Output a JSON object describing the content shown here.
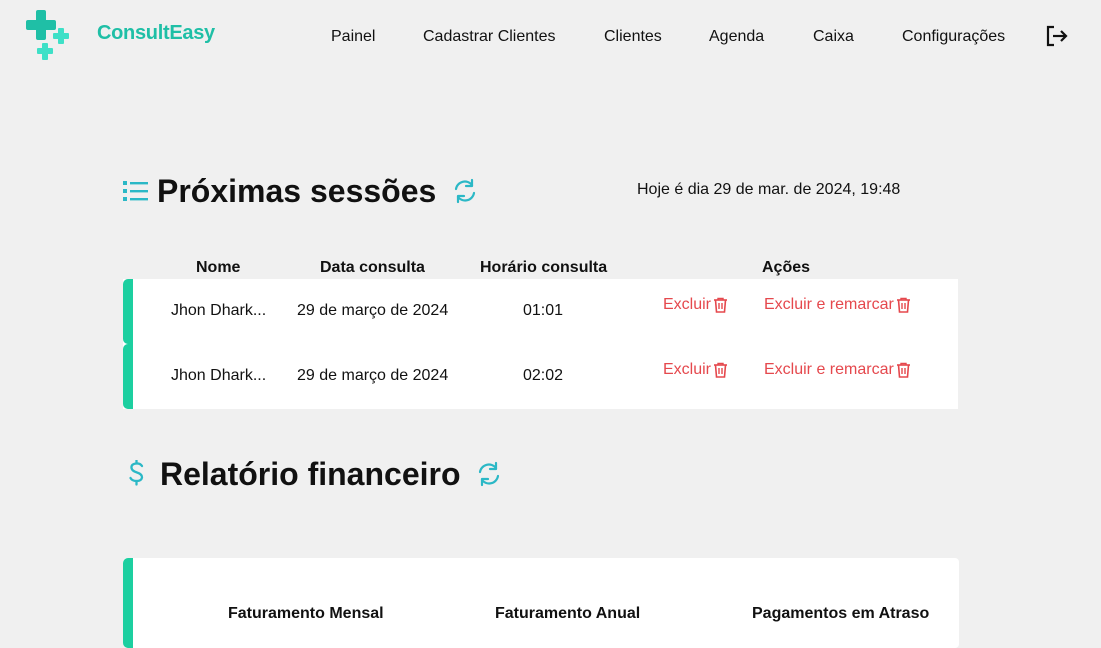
{
  "brand": {
    "name": "ConsultEasy",
    "color": "#1fbfa6"
  },
  "nav": {
    "items": [
      {
        "label": "Painel"
      },
      {
        "label": "Cadastrar Clientes"
      },
      {
        "label": "Clientes"
      },
      {
        "label": "Agenda"
      },
      {
        "label": "Caixa"
      },
      {
        "label": "Configurações"
      }
    ],
    "logout_icon": "logout-icon"
  },
  "sessions": {
    "title": "Próximas sessões",
    "title_icon": "list-icon",
    "refresh_icon": "refresh-icon",
    "today_text": "Hoje é dia 29 de mar. de 2024, 19:48",
    "columns": [
      "Nome",
      "Data consulta",
      "Horário consulta",
      "Ações"
    ],
    "rows": [
      {
        "name": "Jhon Dhark...",
        "date": "29 de março de 2024",
        "time": "01:01",
        "delete_label": "Excluir",
        "reschedule_label": "Excluir e remarcar"
      },
      {
        "name": "Jhon Dhark...",
        "date": "29 de março de 2024",
        "time": "02:02",
        "delete_label": "Excluir",
        "reschedule_label": "Excluir e remarcar"
      }
    ],
    "accent_color": "#1ccfa0",
    "action_color": "#e5484d"
  },
  "finance": {
    "title": "Relatório financeiro",
    "title_icon": "dollar-icon",
    "refresh_icon": "refresh-icon",
    "labels": [
      "Faturamento Mensal",
      "Faturamento Anual",
      "Pagamentos em Atraso"
    ]
  }
}
